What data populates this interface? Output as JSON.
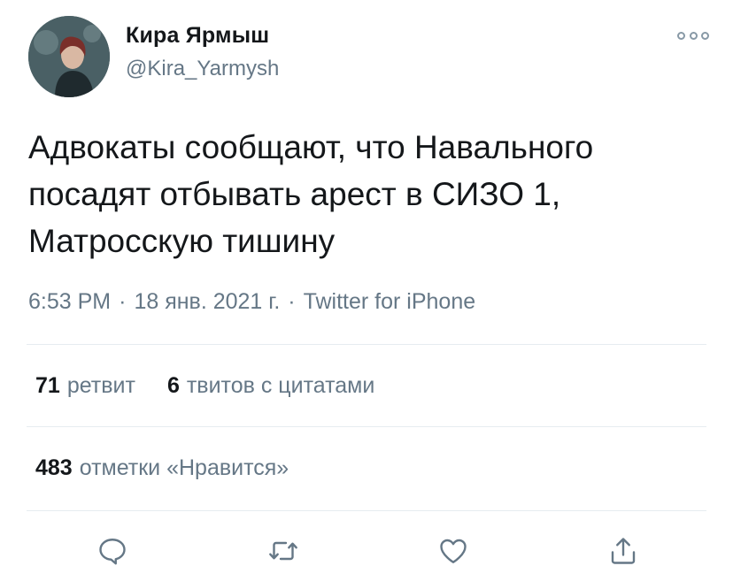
{
  "author": {
    "display_name": "Кира Ярмыш",
    "handle": "@Kira_Yarmysh",
    "avatar_icon": "profile-photo"
  },
  "tweet": {
    "text": "Адвокаты сообщают, что Навального\nпосадят отбывать арест в СИЗО 1,\nМатросскую тишину"
  },
  "meta": {
    "time": "6:53 PM",
    "separator": "·",
    "date": "18 янв. 2021 г.",
    "source": "Twitter for iPhone"
  },
  "stats": {
    "retweets_count": "71",
    "retweets_label": "ретвит",
    "quotes_count": "6",
    "quotes_label": "твитов с цитатами",
    "likes_count": "483",
    "likes_label": "отметки «Нравится»"
  },
  "actions": {
    "reply_icon": "reply-icon",
    "retweet_icon": "retweet-icon",
    "like_icon": "heart-icon",
    "share_icon": "share-icon"
  },
  "colors": {
    "text": "#14171a",
    "secondary": "#657786",
    "icon": "#657786",
    "divider": "#e6ecf0"
  }
}
